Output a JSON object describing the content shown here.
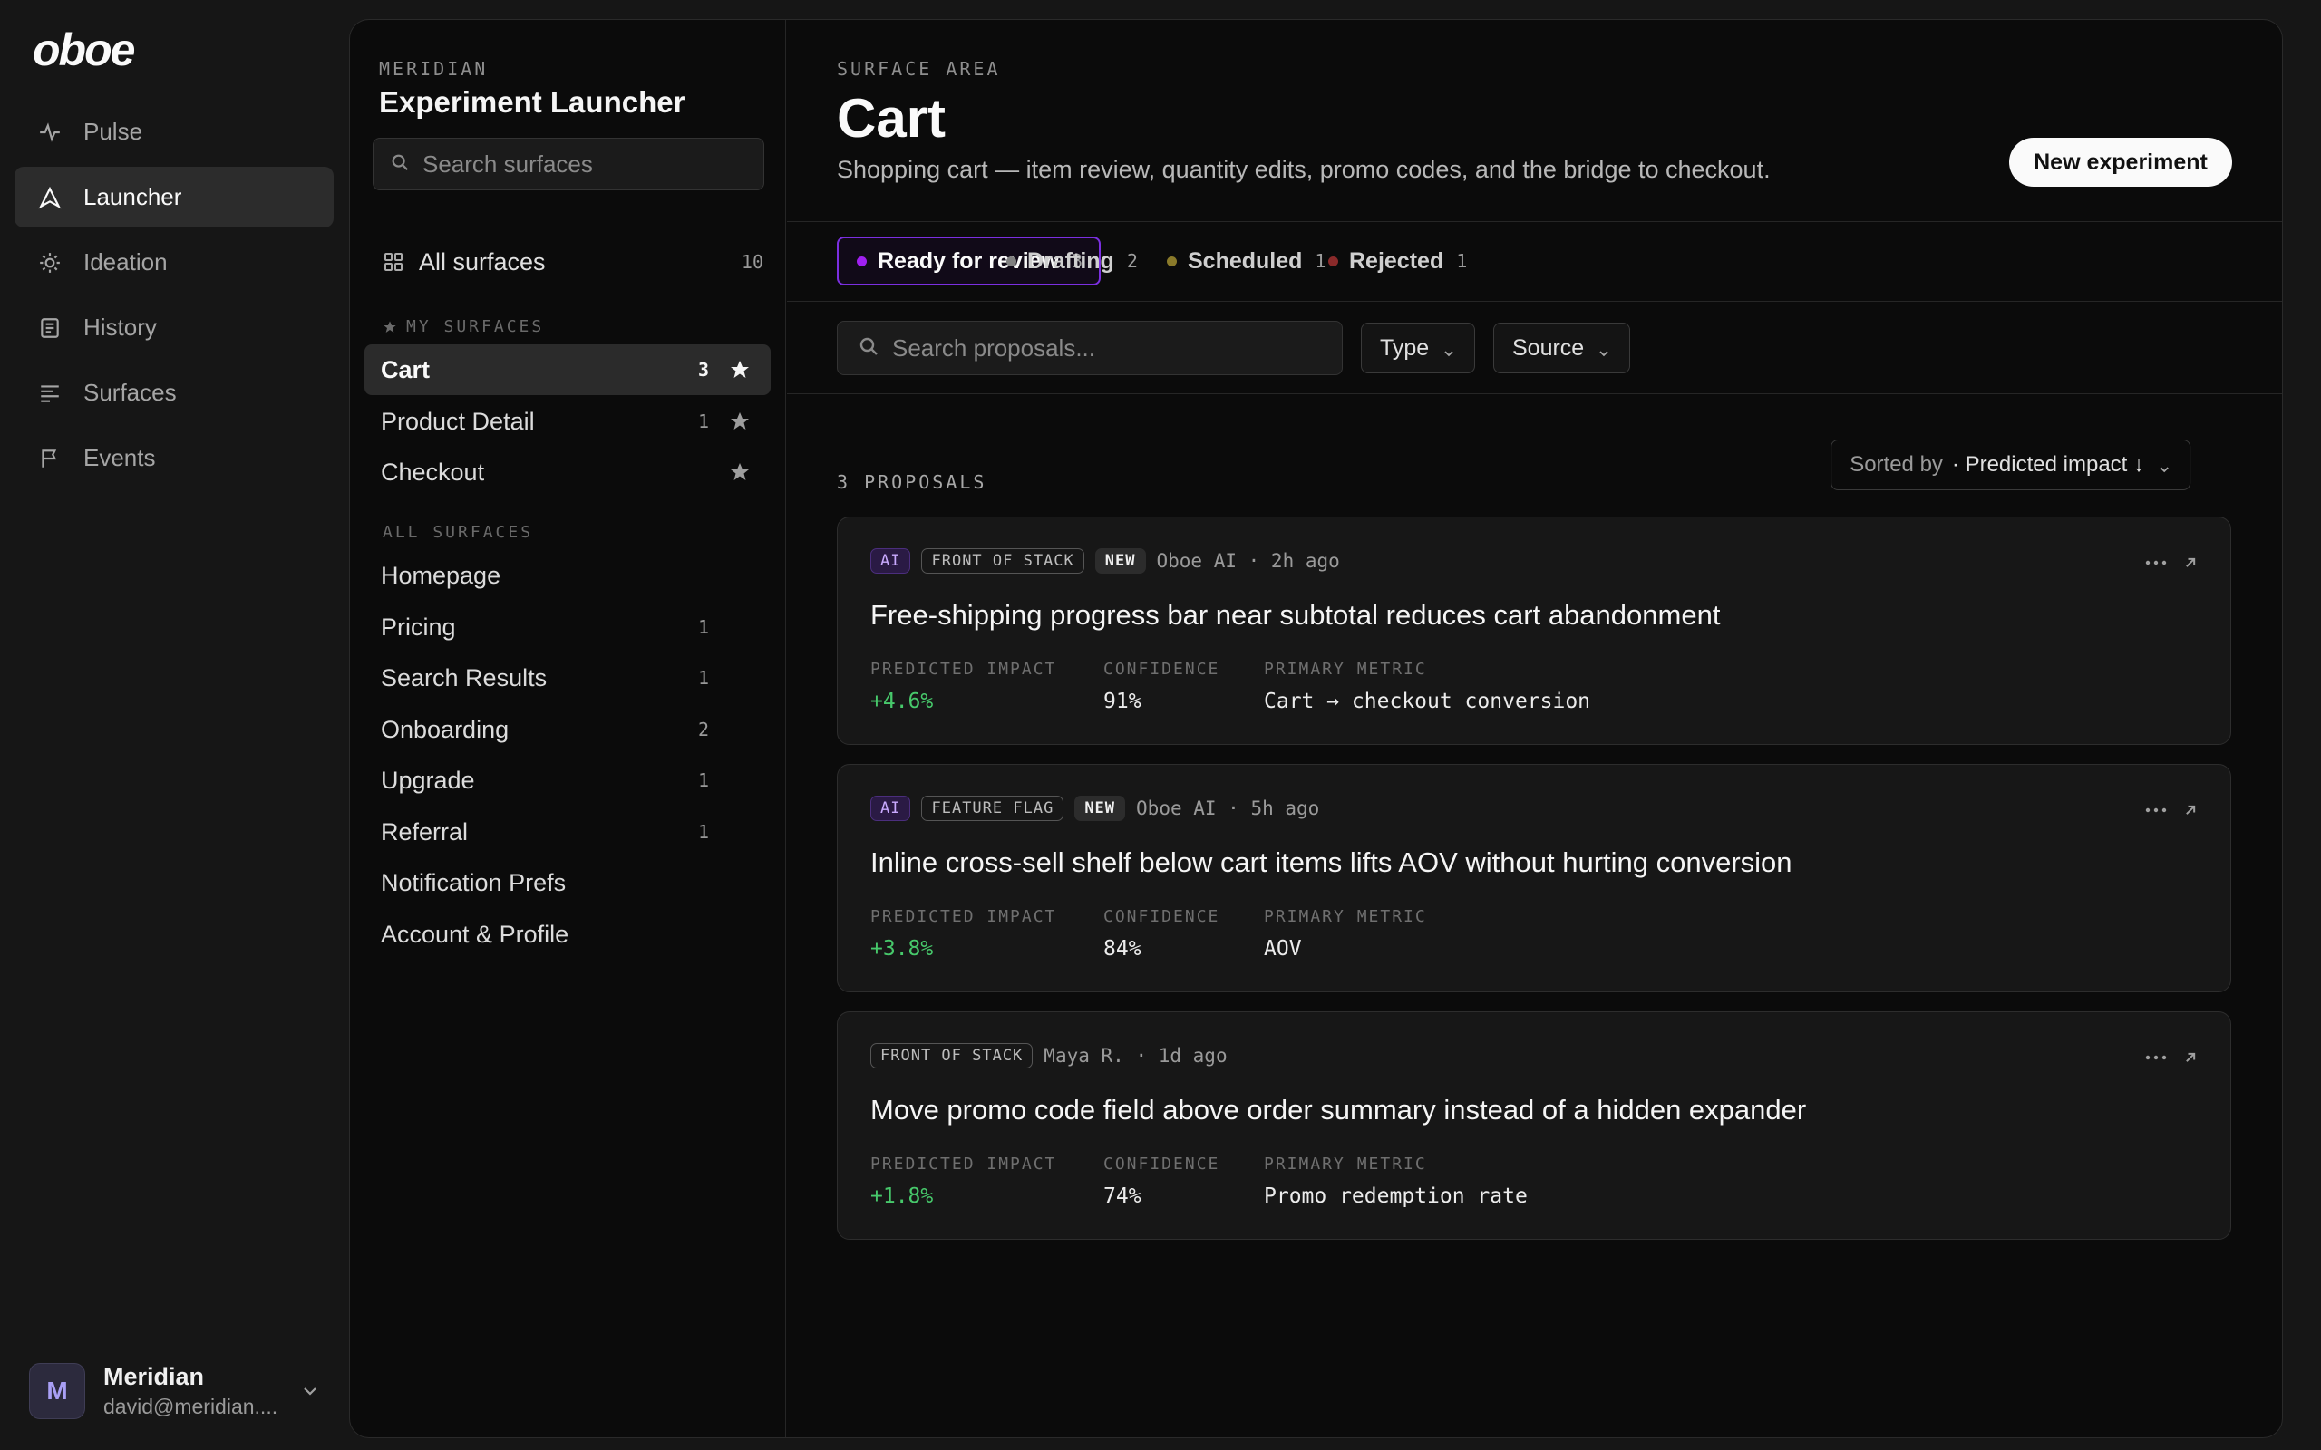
{
  "app": {
    "logo": "oboe"
  },
  "nav": {
    "items": [
      {
        "label": "Pulse",
        "icon": "pulse-icon"
      },
      {
        "label": "Launcher",
        "icon": "launcher-icon",
        "active": true
      },
      {
        "label": "Ideation",
        "icon": "sun-icon"
      },
      {
        "label": "History",
        "icon": "list-icon"
      },
      {
        "label": "Surfaces",
        "icon": "surfaces-icon"
      },
      {
        "label": "Events",
        "icon": "flag-icon"
      }
    ]
  },
  "user": {
    "initial": "M",
    "name": "Meridian",
    "email": "david@meridian...."
  },
  "surfaces": {
    "org": "MERIDIAN",
    "title": "Experiment Launcher",
    "search_placeholder": "Search surfaces",
    "all": {
      "label": "All surfaces",
      "count": "10"
    },
    "my_label": "MY SURFACES",
    "my": [
      {
        "label": "Cart",
        "count": "3",
        "starred": true,
        "active": true
      },
      {
        "label": "Product Detail",
        "count": "1",
        "starred": true
      },
      {
        "label": "Checkout",
        "count": "",
        "starred": true
      }
    ],
    "all_label": "ALL SURFACES",
    "others": [
      {
        "label": "Homepage",
        "count": ""
      },
      {
        "label": "Pricing",
        "count": "1"
      },
      {
        "label": "Search Results",
        "count": "1"
      },
      {
        "label": "Onboarding",
        "count": "2"
      },
      {
        "label": "Upgrade",
        "count": "1"
      },
      {
        "label": "Referral",
        "count": "1"
      },
      {
        "label": "Notification Prefs",
        "count": ""
      },
      {
        "label": "Account & Profile",
        "count": ""
      }
    ]
  },
  "content": {
    "area_label": "SURFACE AREA",
    "title": "Cart",
    "description": "Shopping cart — item review, quantity edits, promo codes, and the bridge to checkout.",
    "new_button": "New experiment",
    "tabs": [
      {
        "label": "Ready for review",
        "count": "3",
        "color": "#a020f0",
        "active": true
      },
      {
        "label": "Drafting",
        "count": "2",
        "color": "#808080"
      },
      {
        "label": "Scheduled",
        "count": "1",
        "color": "#8a7a2a"
      },
      {
        "label": "Rejected",
        "count": "1",
        "color": "#8a2a2a"
      }
    ],
    "search_placeholder": "Search proposals...",
    "filters": {
      "type": "Type",
      "source": "Source"
    },
    "count_label": "3 PROPOSALS",
    "sort": {
      "prefix": "Sorted by",
      "value": "· Predicted impact ↓"
    },
    "stat_labels": {
      "impact": "PREDICTED IMPACT",
      "confidence": "CONFIDENCE",
      "metric": "PRIMARY METRIC"
    },
    "proposals": [
      {
        "ai": "AI",
        "type": "FRONT OF STACK",
        "new": "NEW",
        "source": "Oboe AI · 2h ago",
        "title": "Free-shipping progress bar near subtotal reduces cart abandonment",
        "impact": "+4.6%",
        "confidence": "91%",
        "metric": "Cart → checkout conversion"
      },
      {
        "ai": "AI",
        "type": "FEATURE FLAG",
        "new": "NEW",
        "source": "Oboe AI · 5h ago",
        "title": "Inline cross-sell shelf below cart items lifts AOV without hurting conversion",
        "impact": "+3.8%",
        "confidence": "84%",
        "metric": "AOV"
      },
      {
        "ai": "",
        "type": "FRONT OF STACK",
        "new": "",
        "source": "Maya R. · 1d ago",
        "title": "Move promo code field above order summary instead of a hidden expander",
        "impact": "+1.8%",
        "confidence": "74%",
        "metric": "Promo redemption rate"
      }
    ]
  }
}
